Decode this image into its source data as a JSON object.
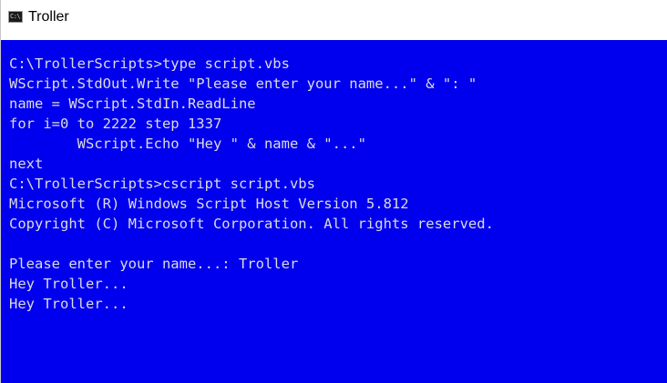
{
  "window": {
    "title": "Troller",
    "icon": "console-icon",
    "icon_glyph": "C:\\"
  },
  "console": {
    "background_color": "#0000ee",
    "text_color": "#dcdcdc",
    "lines": [
      "C:\\TrollerScripts>type script.vbs",
      "WScript.StdOut.Write \"Please enter your name...\" & \": \"",
      "name = WScript.StdIn.ReadLine",
      "for i=0 to 2222 step 1337",
      "        WScript.Echo \"Hey \" & name & \"...\"",
      "next",
      "C:\\TrollerScripts>cscript script.vbs",
      "Microsoft (R) Windows Script Host Version 5.812",
      "Copyright (C) Microsoft Corporation. All rights reserved.",
      "",
      "Please enter your name...: Troller",
      "Hey Troller...",
      "Hey Troller..."
    ]
  }
}
